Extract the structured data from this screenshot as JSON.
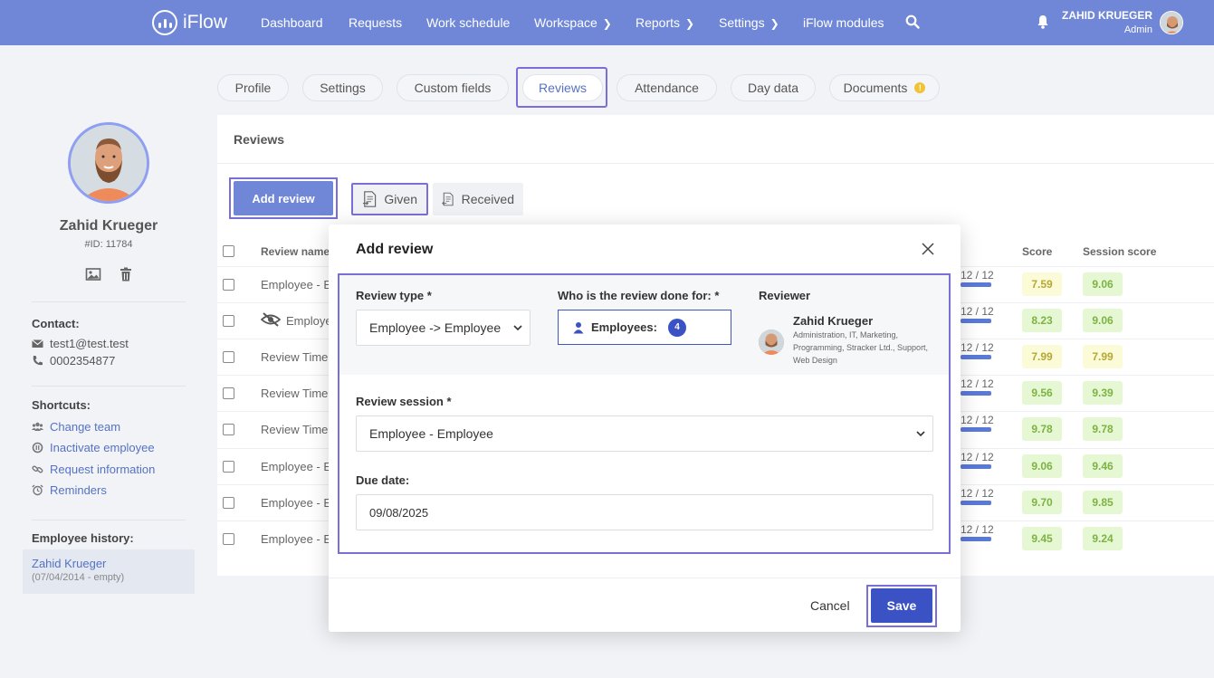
{
  "topnav": {
    "logo": "iFlow",
    "items": [
      {
        "label": "Dashboard",
        "chevron": false
      },
      {
        "label": "Requests",
        "chevron": false
      },
      {
        "label": "Work schedule",
        "chevron": false
      },
      {
        "label": "Workspace",
        "chevron": true
      },
      {
        "label": "Reports",
        "chevron": true
      },
      {
        "label": "Settings",
        "chevron": true
      },
      {
        "label": "iFlow modules",
        "chevron": false
      }
    ],
    "user_name": "ZAHID KRUEGER",
    "user_role": "Admin"
  },
  "employee": {
    "name": "Zahid Krueger",
    "id": "#ID: 11784",
    "contact_label": "Contact:",
    "email": "test1@test.test",
    "phone": "0002354877",
    "shortcuts_label": "Shortcuts:",
    "shortcuts": [
      "Change team",
      "Inactivate employee",
      "Request information",
      "Reminders"
    ],
    "history_label": "Employee history:",
    "history_name": "Zahid Krueger",
    "history_date": "(07/04/2014 - empty)"
  },
  "tabs": [
    {
      "label": "Profile"
    },
    {
      "label": "Settings"
    },
    {
      "label": "Custom fields"
    },
    {
      "label": "Reviews"
    },
    {
      "label": "Attendance"
    },
    {
      "label": "Day data"
    },
    {
      "label": "Documents"
    }
  ],
  "active_tab": "Reviews",
  "reviews": {
    "title": "Reviews",
    "add_button": "Add review",
    "given": "Given",
    "received": "Received",
    "columns": {
      "name": "Review name",
      "score": "Score",
      "session_score": "Session score"
    },
    "rows": [
      {
        "name": "Employee - Er",
        "hidden": false,
        "progress": "12 / 12",
        "score": "7.59",
        "session": "9.06",
        "score_color": "yellow",
        "session_color": "green"
      },
      {
        "name": "Employe",
        "hidden": true,
        "progress": "12 / 12",
        "score": "8.23",
        "session": "9.06",
        "score_color": "green",
        "session_color": "green"
      },
      {
        "name": "Review Time",
        "hidden": false,
        "progress": "12 / 12",
        "score": "7.99",
        "session": "7.99",
        "score_color": "yellow",
        "session_color": "yellow"
      },
      {
        "name": "Review Time",
        "hidden": false,
        "progress": "12 / 12",
        "score": "9.56",
        "session": "9.39",
        "score_color": "green",
        "session_color": "green"
      },
      {
        "name": "Review Time",
        "hidden": false,
        "progress": "12 / 12",
        "score": "9.78",
        "session": "9.78",
        "score_color": "green",
        "session_color": "green"
      },
      {
        "name": "Employee - Er",
        "hidden": false,
        "progress": "12 / 12",
        "score": "9.06",
        "session": "9.46",
        "score_color": "green",
        "session_color": "green"
      },
      {
        "name": "Employee - Er",
        "hidden": false,
        "progress": "12 / 12",
        "score": "9.70",
        "session": "9.85",
        "score_color": "green",
        "session_color": "green"
      },
      {
        "name": "Employee - Er",
        "hidden": false,
        "progress": "12 / 12",
        "score": "9.45",
        "session": "9.24",
        "score_color": "green",
        "session_color": "green"
      }
    ]
  },
  "modal": {
    "title": "Add review",
    "review_type_label": "Review type *",
    "review_type_value": "Employee -> Employee",
    "done_for_label": "Who is the review done for: *",
    "employees_label": "Employees:",
    "employees_count": "4",
    "reviewer_label": "Reviewer",
    "reviewer_name": "Zahid Krueger",
    "reviewer_departments": "Administration, IT, Marketing, Programming, Stracker Ltd., Support, Web Design",
    "session_label": "Review session *",
    "session_value": "Employee - Employee",
    "due_label": "Due date:",
    "due_value": "09/08/2025",
    "cancel": "Cancel",
    "save": "Save"
  }
}
